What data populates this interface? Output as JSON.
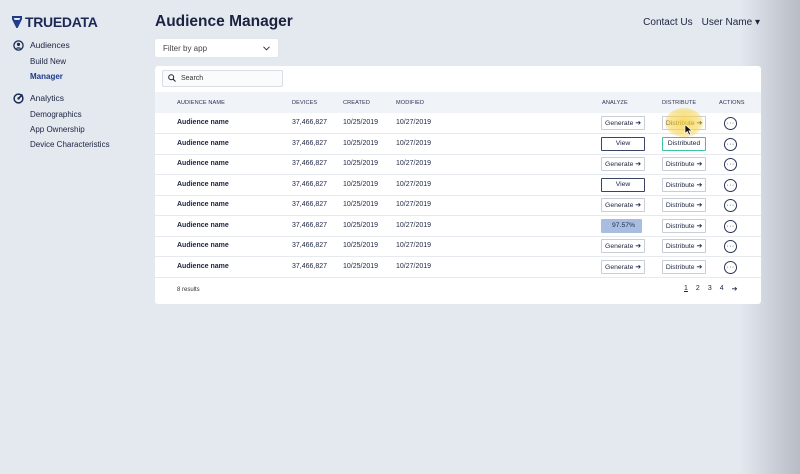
{
  "brand": {
    "name": "TRUEDATA"
  },
  "sidebar": {
    "audiences": {
      "label": "Audiences",
      "items": [
        "Build New",
        "Manager"
      ]
    },
    "analytics": {
      "label": "Analytics",
      "items": [
        "Demographics",
        "App Ownership",
        "Device Characteristics"
      ]
    }
  },
  "header": {
    "title": "Audience Manager",
    "contact": "Contact Us",
    "user": "User Name ▾"
  },
  "filter": {
    "label": "Filter by app"
  },
  "search": {
    "placeholder": "Search"
  },
  "table": {
    "columns": [
      "AUDIENCE NAME",
      "DEVICES",
      "CREATED",
      "MODIFIED",
      "ANALYZE",
      "DISTRIBUTE",
      "ACTIONS"
    ],
    "rows": [
      {
        "name": "Audience name",
        "devices": "37,466,827",
        "created": "10/25/2019",
        "modified": "10/27/2019",
        "analyze": "Generate ➔",
        "distribute": "Distribute ➔",
        "actions": "···"
      },
      {
        "name": "Audience name",
        "devices": "37,466,827",
        "created": "10/25/2019",
        "modified": "10/27/2019",
        "analyze": "View",
        "distribute": "Distributed",
        "actions": "···"
      },
      {
        "name": "Audience name",
        "devices": "37,466,827",
        "created": "10/25/2019",
        "modified": "10/27/2019",
        "analyze": "Generate ➔",
        "distribute": "Distribute ➔",
        "actions": "···"
      },
      {
        "name": "Audience name",
        "devices": "37,466,827",
        "created": "10/25/2019",
        "modified": "10/27/2019",
        "analyze": "View",
        "distribute": "Distribute ➔",
        "actions": "···"
      },
      {
        "name": "Audience name",
        "devices": "37,466,827",
        "created": "10/25/2019",
        "modified": "10/27/2019",
        "analyze": "Generate ➔",
        "distribute": "Distribute ➔",
        "actions": "···"
      },
      {
        "name": "Audience name",
        "devices": "37,466,827",
        "created": "10/25/2019",
        "modified": "10/27/2019",
        "analyze": "97.57%",
        "distribute": "Distribute ➔",
        "actions": "···"
      },
      {
        "name": "Audience name",
        "devices": "37,466,827",
        "created": "10/25/2019",
        "modified": "10/27/2019",
        "analyze": "Generate ➔",
        "distribute": "Distribute ➔",
        "actions": "···"
      },
      {
        "name": "Audience name",
        "devices": "37,466,827",
        "created": "10/25/2019",
        "modified": "10/27/2019",
        "analyze": "Generate ➔",
        "distribute": "Distribute ➔",
        "actions": "···"
      }
    ]
  },
  "footer": {
    "results": "8 results",
    "pages": [
      "1",
      "2",
      "3",
      "4"
    ],
    "current_page": "1",
    "next": "➔"
  },
  "colors": {
    "accent": "#1f3a8a",
    "progress": "#a9bde0",
    "distributed_border": "#3fc4a0",
    "cursor_highlight": "#f8d346"
  }
}
